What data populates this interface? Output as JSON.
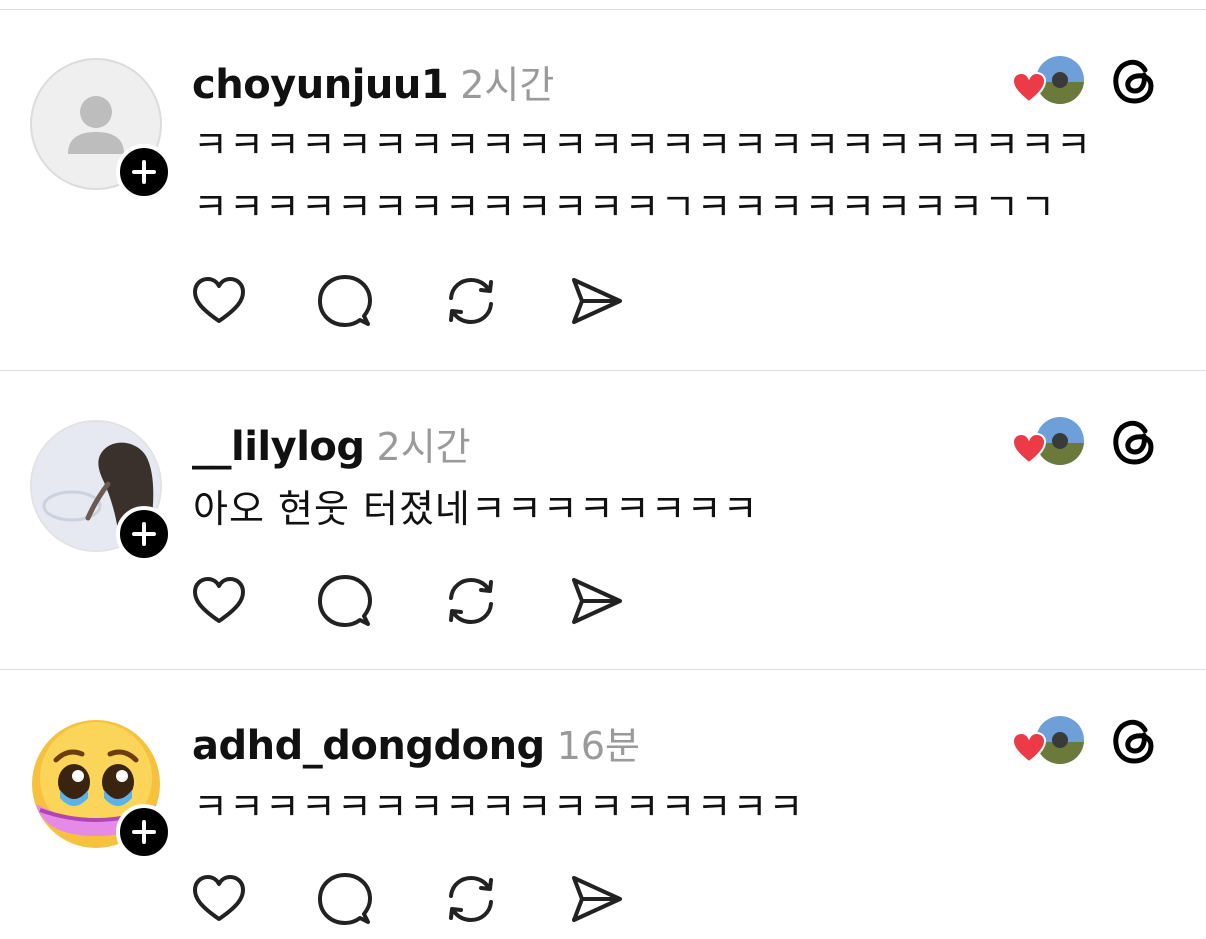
{
  "posts": [
    {
      "username": "choyunjuu1",
      "time": "2시간",
      "text_lines": [
        "ㅋㅋㅋㅋㅋㅋㅋㅋㅋㅋㅋㅋㅋㅋㅋㅋㅋㅋㅋㅋㅋㅋㅋㅋㅋ",
        "ㅋㅋㅋㅋㅋㅋㅋㅋㅋㅋㅋㅋㅋㄱㅋㅋㅋㅋㅋㅋㅋㅋㄱㄱ"
      ],
      "avatar": "default-person"
    },
    {
      "username": "__lilylog",
      "time": "2시간",
      "text_lines": [
        "아오 현웃 터졌네ㅋㅋㅋㅋㅋㅋㅋㅋ"
      ],
      "avatar": "photo-girl-snow"
    },
    {
      "username": "adhd_dongdong",
      "time": "16분",
      "text_lines": [
        "ㅋㅋㅋㅋㅋㅋㅋㅋㅋㅋㅋㅋㅋㅋㅋㅋㅋ"
      ],
      "avatar": "pleading-emoji"
    }
  ],
  "icons": {
    "like": "heart-outline-icon",
    "reply": "speech-bubble-icon",
    "repost": "repost-arrows-icon",
    "share": "paper-plane-icon",
    "liked_by_author": "red-heart-icon",
    "threads": "threads-logo-icon"
  },
  "colors": {
    "heart_red": "#ed3a47",
    "time_gray": "#9a9a9a",
    "divider": "#dcdcdc"
  }
}
